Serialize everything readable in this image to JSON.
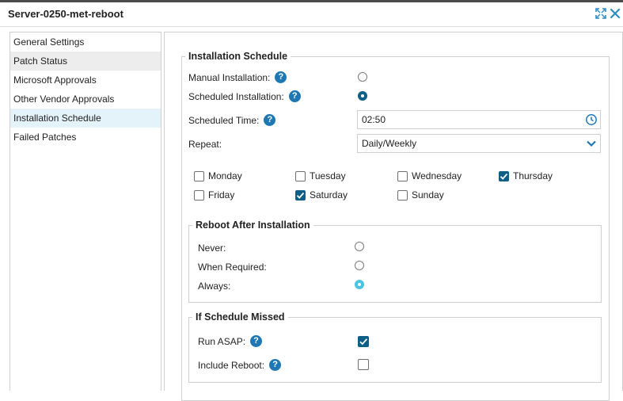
{
  "window": {
    "title": "Server-0250-met-reboot"
  },
  "sidebar": {
    "items": [
      {
        "label": "General Settings"
      },
      {
        "label": "Patch Status"
      },
      {
        "label": "Microsoft Approvals"
      },
      {
        "label": "Other Vendor Approvals"
      },
      {
        "label": "Installation Schedule"
      },
      {
        "label": "Failed Patches"
      }
    ]
  },
  "installation": {
    "legend": "Installation Schedule",
    "manual_label": "Manual Installation:",
    "scheduled_label": "Scheduled Installation:",
    "time_label": "Scheduled Time:",
    "time_value": "02:50",
    "repeat_label": "Repeat:",
    "repeat_value": "Daily/Weekly",
    "days": {
      "monday": "Monday",
      "tuesday": "Tuesday",
      "wednesday": "Wednesday",
      "thursday": "Thursday",
      "friday": "Friday",
      "saturday": "Saturday",
      "sunday": "Sunday"
    }
  },
  "reboot": {
    "legend": "Reboot After Installation",
    "never_label": "Never:",
    "when_required_label": "When Required:",
    "always_label": "Always:"
  },
  "missed": {
    "legend": "If Schedule Missed",
    "run_asap_label": "Run ASAP:",
    "include_reboot_label": "Include Reboot:"
  },
  "help_glyph": "?",
  "colors": {
    "accent": "#0d5f85",
    "help": "#1f78b4",
    "active_nav": "#e4f3fa",
    "highlight_radio": "#4ec3e0"
  }
}
